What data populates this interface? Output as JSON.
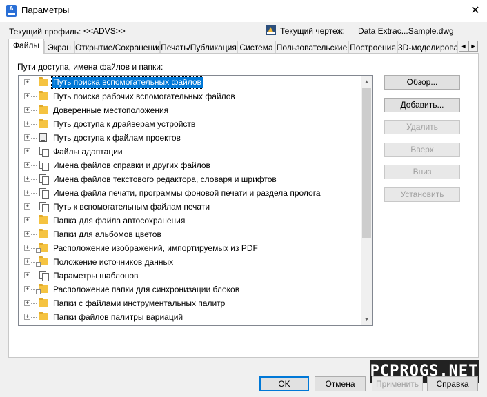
{
  "window": {
    "title": "Параметры",
    "close_glyph": "✕",
    "app_icon_letter": "A"
  },
  "profile": {
    "label": "Текущий профиль:",
    "value": "<<ADVS>>"
  },
  "drawing": {
    "label": "Текущий чертеж:",
    "value": "Data Extrac...Sample.dwg"
  },
  "tabs": [
    {
      "label": "Файлы"
    },
    {
      "label": "Экран"
    },
    {
      "label": "Открытие/Сохранение"
    },
    {
      "label": "Печать/Публикация"
    },
    {
      "label": "Система"
    },
    {
      "label": "Пользовательские"
    },
    {
      "label": "Построения"
    },
    {
      "label": "3D-моделирова"
    }
  ],
  "tab_scroll": {
    "left": "◄",
    "right": "►"
  },
  "panel": {
    "label": "Пути доступа, имена файлов и папки:"
  },
  "tree": {
    "items": [
      {
        "label": "Путь поиска вспомогательных файлов",
        "icon": "folder-icon",
        "selected": true
      },
      {
        "label": "Путь поиска рабочих вспомогательных файлов",
        "icon": "folder-icon"
      },
      {
        "label": "Доверенные местоположения",
        "icon": "folder-icon"
      },
      {
        "label": "Путь доступа к драйверам устройств",
        "icon": "folder-icon"
      },
      {
        "label": "Путь доступа к файлам проектов",
        "icon": "document-icon"
      },
      {
        "label": "Файлы адаптации",
        "icon": "pages-icon"
      },
      {
        "label": "Имена файлов справки и других файлов",
        "icon": "pages-icon"
      },
      {
        "label": "Имена файлов текстового редактора, словаря и шрифтов",
        "icon": "pages-icon"
      },
      {
        "label": "Имена файла печати, программы фоновой печати и раздела пролога",
        "icon": "pages-icon"
      },
      {
        "label": "Путь к вспомогательным файлам печати",
        "icon": "pages-icon"
      },
      {
        "label": "Папка для файла автосохранения",
        "icon": "folder-icon"
      },
      {
        "label": "Папки для альбомов цветов",
        "icon": "folder-icon"
      },
      {
        "label": "Расположение изображений, импортируемых из PDF",
        "icon": "folder-icon"
      },
      {
        "label": "Положение источников данных",
        "icon": "folder-icon"
      },
      {
        "label": "Параметры шаблонов",
        "icon": "pages-icon"
      },
      {
        "label": "Расположение папки для синхронизации блоков",
        "icon": "folder-icon"
      },
      {
        "label": "Папки с файлами инструментальных палитр",
        "icon": "folder-icon"
      },
      {
        "label": "Папки файлов палитры вариаций",
        "icon": "folder-icon"
      }
    ],
    "expander_glyph": "+"
  },
  "side_buttons": [
    {
      "label": "Обзор...",
      "enabled": true
    },
    {
      "label": "Добавить...",
      "enabled": true
    },
    {
      "label": "Удалить",
      "enabled": false
    },
    {
      "label": "Вверх",
      "enabled": false
    },
    {
      "label": "Вниз",
      "enabled": false
    },
    {
      "label": "Установить",
      "enabled": false
    }
  ],
  "footer": {
    "ok": "OK",
    "cancel": "Отмена",
    "apply": "Применить",
    "help": "Справка"
  },
  "watermark": "PCPROGS.NET",
  "colors": {
    "selection": "#0078d7",
    "folder": "#f5c341",
    "accent": "#0078d7"
  }
}
